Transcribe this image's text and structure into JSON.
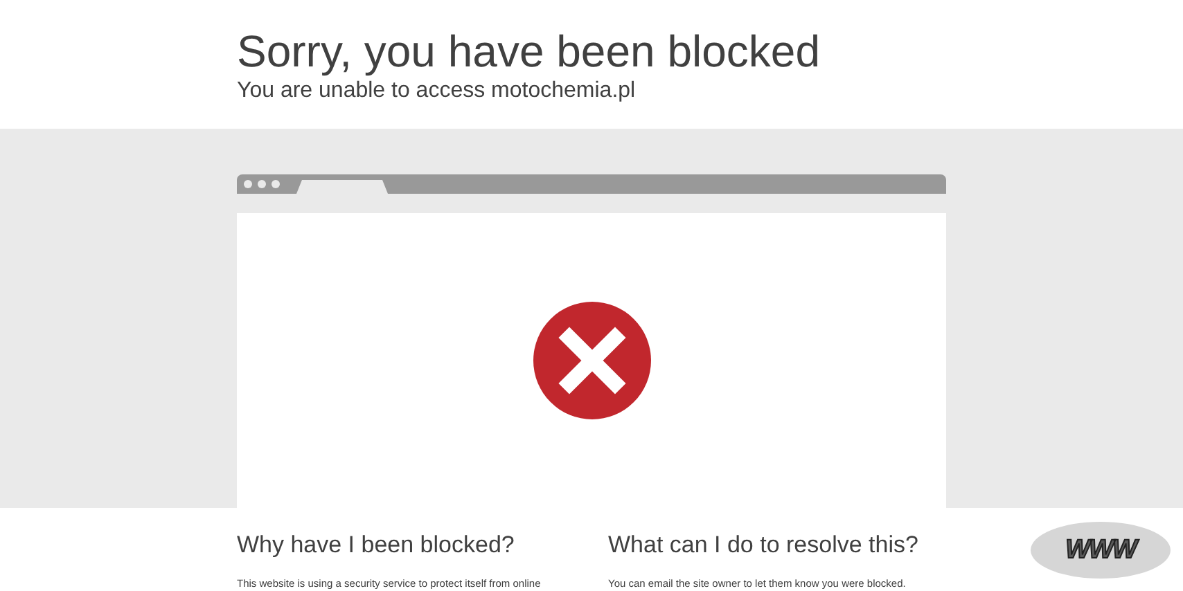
{
  "header": {
    "title": "Sorry, you have been blocked",
    "subtitle": "You are unable to access motochemia.pl"
  },
  "sections": [
    {
      "heading": "Why have I been blocked?",
      "text": "This website is using a security service to protect itself from online"
    },
    {
      "heading": "What can I do to resolve this?",
      "text": "You can email the site owner to let them know you were blocked."
    }
  ],
  "badge": {
    "label": "WWW"
  }
}
